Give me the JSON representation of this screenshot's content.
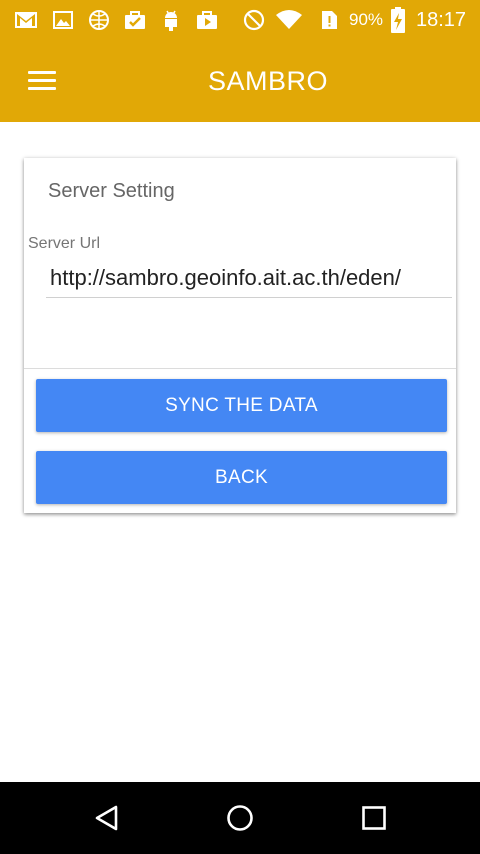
{
  "status_bar": {
    "battery_percent": "90%",
    "time": "18:17",
    "icons": [
      "gmail-icon",
      "gallery-icon",
      "globe-icon",
      "check-briefcase-icon",
      "android-icon",
      "play-briefcase-icon",
      "do-not-disturb-icon",
      "wifi-icon",
      "sim-alert-icon",
      "battery-charging-icon"
    ]
  },
  "app_bar": {
    "title": "SAMBRO",
    "menu_icon": "hamburger-menu-icon"
  },
  "card": {
    "title": "Server Setting",
    "server_url_label": "Server Url",
    "server_url_value": "http://sambro.geoinfo.ait.ac.th/eden/",
    "sync_button_label": "SYNC THE DATA",
    "back_button_label": "BACK"
  },
  "nav_bar": {
    "icons": [
      "back-triangle-icon",
      "home-circle-icon",
      "recents-square-icon"
    ]
  },
  "colors": {
    "primary": "#e1a806",
    "button": "#4487f4",
    "nav_background": "#000000"
  }
}
